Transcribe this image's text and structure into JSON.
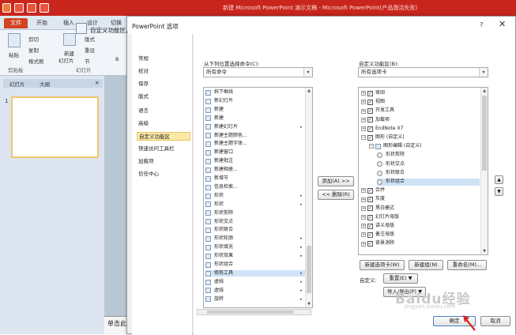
{
  "powerpoint": {
    "title": "新建 Microsoft PowerPoint 演示文稿 - Microsoft PowerPoint(产品激活失败)",
    "tabs": [
      "文件",
      "开始",
      "插入",
      "设计",
      "切换"
    ],
    "ribbon": {
      "paste": "粘贴",
      "cut": "剪切",
      "copy": "复制",
      "format_painter": "格式刷",
      "new_slide": "新建",
      "new_slide2": "幻灯片",
      "layout": "版式",
      "reset": "重设",
      "section": "节",
      "clipboard_group": "剪贴板",
      "slides_group": "幻灯片",
      "b": "B"
    },
    "panel_tabs": [
      "幻灯片",
      "大纲"
    ],
    "slide_number": "1",
    "notes": "单击此"
  },
  "dialog": {
    "title": "PowerPoint 选项",
    "help": "?",
    "close": "✕",
    "nav": [
      "常规",
      "校对",
      "保存",
      "版式",
      "语言",
      "高级",
      "自定义功能区",
      "快速访问工具栏",
      "加载项",
      "信任中心"
    ],
    "selected_nav": "自定义功能区",
    "header": "自定义功能区。",
    "left_label": "从下列位置选择命令(C):",
    "left_combo": "所有命令",
    "right_label": "自定义功能区(B):",
    "right_combo": "所有选项卡",
    "commands": [
      {
        "label": "斜下框线",
        "arrow": ""
      },
      {
        "label": "新幻灯片",
        "arrow": ""
      },
      {
        "label": "新建",
        "arrow": ""
      },
      {
        "label": "新建",
        "arrow": ""
      },
      {
        "label": "新建幻灯片",
        "arrow": "▸"
      },
      {
        "label": "新建主题颜色...",
        "arrow": ""
      },
      {
        "label": "新建主题字体...",
        "arrow": ""
      },
      {
        "label": "新建窗口",
        "arrow": ""
      },
      {
        "label": "新建批注",
        "arrow": ""
      },
      {
        "label": "新建相册...",
        "arrow": ""
      },
      {
        "label": "新增节",
        "arrow": ""
      },
      {
        "label": "信息检索...",
        "arrow": ""
      },
      {
        "label": "形状",
        "arrow": "▸"
      },
      {
        "label": "形状",
        "arrow": "▸"
      },
      {
        "label": "形状剪除",
        "arrow": ""
      },
      {
        "label": "形状交点",
        "arrow": ""
      },
      {
        "label": "形状联合",
        "arrow": ""
      },
      {
        "label": "形状轮廓",
        "arrow": "▸"
      },
      {
        "label": "形状填充",
        "arrow": "▸"
      },
      {
        "label": "形状效果",
        "arrow": "▸"
      },
      {
        "label": "形状组合",
        "arrow": ""
      },
      {
        "label": "修剪工具",
        "arrow": "▸"
      },
      {
        "label": "虚线",
        "arrow": "▸"
      },
      {
        "label": "虚线",
        "arrow": "▸"
      },
      {
        "label": "旋转",
        "arrow": "▸"
      }
    ],
    "selected_command": "修剪工具",
    "add_button": "添加(A) >>",
    "remove_button": "<< 删除(R)",
    "ribbon_tree": [
      {
        "label": "审阅",
        "level": 0,
        "kind": "tab",
        "checked": true,
        "expand": "⊞"
      },
      {
        "label": "视图",
        "level": 0,
        "kind": "tab",
        "checked": true,
        "expand": "⊞"
      },
      {
        "label": "开发工具",
        "level": 0,
        "kind": "tab",
        "checked": true,
        "expand": "⊞"
      },
      {
        "label": "加载项",
        "level": 0,
        "kind": "tab",
        "checked": true,
        "expand": "⊞"
      },
      {
        "label": "EndNote X7",
        "level": 0,
        "kind": "tab",
        "checked": true,
        "expand": "⊞"
      },
      {
        "label": "图形 (自定义)",
        "level": 0,
        "kind": "tab",
        "checked": true,
        "expand": "⊟"
      },
      {
        "label": "图形编辑 (自定义)",
        "level": 1,
        "kind": "group",
        "checked": false,
        "expand": "⊟"
      },
      {
        "label": "形状剪除",
        "level": 2,
        "kind": "cmd",
        "checked": false,
        "expand": ""
      },
      {
        "label": "形状交点",
        "level": 2,
        "kind": "cmd",
        "checked": false,
        "expand": ""
      },
      {
        "label": "形状联合",
        "level": 2,
        "kind": "cmd",
        "checked": false,
        "expand": ""
      },
      {
        "label": "形状组合",
        "level": 2,
        "kind": "cmd",
        "checked": false,
        "expand": ""
      },
      {
        "label": "合并",
        "level": 0,
        "kind": "tab",
        "checked": true,
        "expand": "⊞"
      },
      {
        "label": "灰度",
        "level": 0,
        "kind": "tab",
        "checked": true,
        "expand": "⊞"
      },
      {
        "label": "黑白模式",
        "level": 0,
        "kind": "tab",
        "checked": true,
        "expand": "⊞"
      },
      {
        "label": "幻灯片母版",
        "level": 0,
        "kind": "tab",
        "checked": true,
        "expand": "⊞"
      },
      {
        "label": "讲义母版",
        "level": 0,
        "kind": "tab",
        "checked": true,
        "expand": "⊞"
      },
      {
        "label": "备注母版",
        "level": 0,
        "kind": "tab",
        "checked": true,
        "expand": "⊞"
      },
      {
        "label": "背景消除",
        "level": 0,
        "kind": "tab",
        "checked": true,
        "expand": "⊞"
      }
    ],
    "selected_tree_item": "形状组合",
    "move_up": "▲",
    "move_down": "▼",
    "new_tab_button": "新建选项卡(W)",
    "new_group_button": "新建组(N)",
    "rename_button": "重命名(M)...",
    "customize_label": "自定义:",
    "reset_button": "重置(E) ▼",
    "import_export_button": "导入/导出(P) ▼",
    "ok_button": "确定",
    "cancel_button": "取消"
  },
  "watermark": {
    "text": "Baidu经验",
    "url": "jingyan.baidu.com"
  },
  "colors": {
    "ppt_red": "#c8261d",
    "selection": "#fde8a8",
    "arrow_red": "#d7261e"
  }
}
